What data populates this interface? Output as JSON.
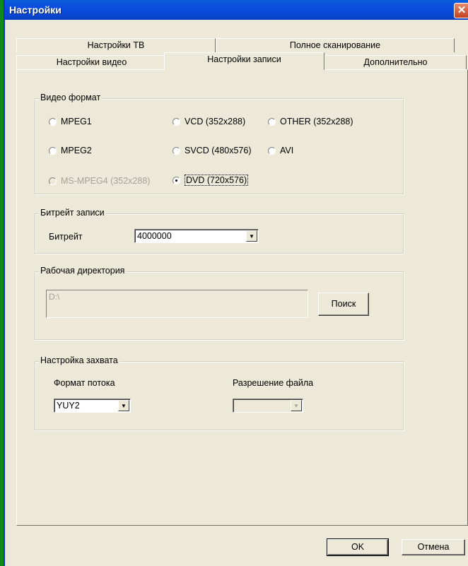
{
  "window": {
    "title": "Настройки",
    "close_icon": "close-icon"
  },
  "tabs": {
    "row1": [
      "Настройки ТВ",
      "Полное сканирование"
    ],
    "row2": [
      "Настройки видео",
      "Настройки записи",
      "Дополнительно"
    ],
    "active": "Настройки записи"
  },
  "video_format": {
    "legend": "Видео формат",
    "options": [
      "MPEG1",
      "VCD (352x288)",
      "OTHER (352x288)",
      "MPEG2",
      "SVCD (480x576)",
      "AVI",
      "MS-MPEG4 (352x288)",
      "DVD (720x576)"
    ],
    "selected": "DVD (720x576)",
    "disabled": [
      "MS-MPEG4 (352x288)"
    ]
  },
  "bitrate": {
    "legend": "Битрейт записи",
    "label": "Битрейт",
    "value": "4000000"
  },
  "workdir": {
    "legend": "Рабочая директория",
    "path": "D:\\",
    "browse_label": "Поиск"
  },
  "capture": {
    "legend": "Настройка захвата",
    "stream_label": "Формат потока",
    "stream_value": "YUY2",
    "resolution_label": "Разрешение файла",
    "resolution_value": ""
  },
  "buttons": {
    "ok": "OK",
    "cancel": "Отмена"
  }
}
